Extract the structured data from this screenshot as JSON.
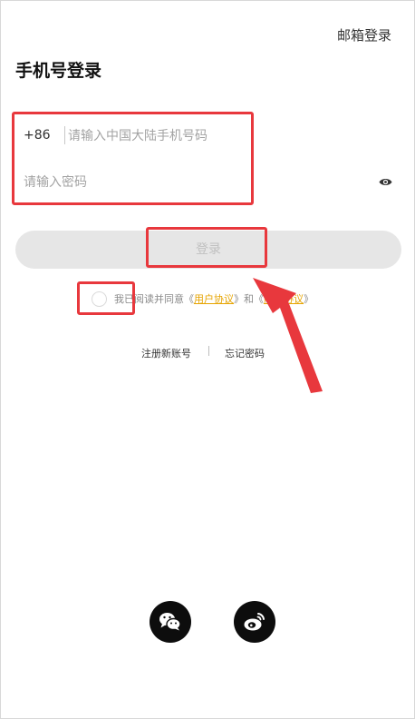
{
  "header": {
    "email_login": "邮箱登录",
    "title": "手机号登录"
  },
  "form": {
    "country_code": "+86",
    "phone": {
      "value": "",
      "placeholder": "请输入中国大陆手机号码"
    },
    "password": {
      "value": "",
      "placeholder": "请输入密码",
      "icon": "eye-icon"
    },
    "login_button": "登录"
  },
  "agreement": {
    "checked": false,
    "prefix": "我已阅读并同意",
    "open_quote": "《",
    "user_agreement": "用户协议",
    "close_quote": "》",
    "conjunction": "和",
    "privacy_open_quote": "《",
    "privacy_policy": "隐私协议",
    "privacy_close_quote": "》"
  },
  "links": {
    "register": "注册新账号",
    "forgot_password": "忘记密码"
  },
  "social": [
    {
      "icon": "wechat-icon"
    },
    {
      "icon": "weibo-icon"
    }
  ],
  "colors": {
    "accent": "#e6a400",
    "button_bg": "#e6e6e6",
    "button_text": "#c0c0c0",
    "social_bg": "#0d0d0d",
    "annotation": "#e8383d"
  }
}
